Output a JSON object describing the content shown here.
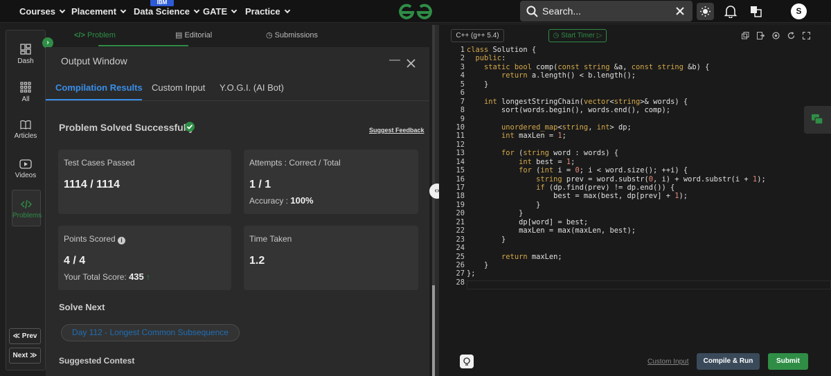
{
  "nav": {
    "items": [
      "Courses",
      "Placement",
      "Data Science",
      "GATE",
      "Practice"
    ],
    "badge": "IBM",
    "search_placeholder": "Search...",
    "avatar": "S"
  },
  "sidebar": {
    "items": [
      "Dash",
      "All",
      "Articles",
      "Videos",
      "Problems"
    ],
    "prev": "≪ Prev",
    "next": "Next ≫"
  },
  "left_tabs": {
    "problem": "Problem",
    "editorial": "Editorial",
    "submissions": "Submissions"
  },
  "output_window": {
    "title": "Output Window",
    "tabs": [
      "Compilation Results",
      "Custom Input",
      "Y.O.G.I. (AI Bot)"
    ],
    "status": "Problem Solved Successfully",
    "feedback_link": "Suggest Feedback",
    "test_cases_label": "Test Cases Passed",
    "test_cases_value": "1114 / 1114",
    "attempts_label": "Attempts : Correct / Total",
    "attempts_value": "1 / 1",
    "accuracy_label": "Accuracy :",
    "accuracy_value": "100%",
    "points_label": "Points Scored",
    "points_value": "4 / 4",
    "total_score_label": "Your Total Score:",
    "total_score_value": "435",
    "time_label": "Time Taken",
    "time_value": "1.2",
    "solve_next_label": "Solve Next",
    "solve_next_item": "Day 112 - Longest Common Subsequence",
    "suggested_contest_label": "Suggested Contest"
  },
  "editor": {
    "language": "C++ (g++ 5.4)",
    "timer": "Start Timer",
    "custom_input_link": "Custom Input",
    "compile_button": "Compile & Run",
    "submit_button": "Submit",
    "code_lines": [
      "class Solution {",
      "  public:",
      "    static bool comp(const string &a, const string &b) {",
      "        return a.length() < b.length();",
      "    }",
      "",
      "    int longestStringChain(vector<string>& words) {",
      "        sort(words.begin(), words.end(), comp);",
      "",
      "        unordered_map<string, int> dp;",
      "        int maxLen = 1;",
      "",
      "        for (string word : words) {",
      "            int best = 1;",
      "            for (int i = 0; i < word.size(); ++i) {",
      "                string prev = word.substr(0, i) + word.substr(i + 1);",
      "                if (dp.find(prev) != dp.end()) {",
      "                    best = max(best, dp[prev] + 1);",
      "                }",
      "            }",
      "            dp[word] = best;",
      "            maxLen = max(maxLen, best);",
      "        }",
      "",
      "        return maxLen;",
      "    }",
      "};",
      ""
    ]
  }
}
